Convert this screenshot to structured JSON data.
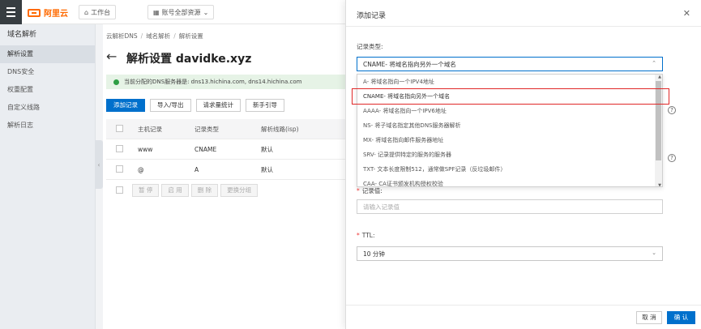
{
  "topbar": {
    "logo_text": "阿里云",
    "home_label": "工作台",
    "resource_label": "账号全部资源"
  },
  "sidebar": {
    "title": "域名解析",
    "items": [
      {
        "label": "解析设置",
        "active": true
      },
      {
        "label": "DNS安全"
      },
      {
        "label": "权重配置"
      },
      {
        "label": "自定义线路"
      },
      {
        "label": "解析日志"
      }
    ]
  },
  "main": {
    "breadcrumb": [
      "云解析DNS",
      "域名解析",
      "解析设置"
    ],
    "title": "解析设置 davidke.xyz",
    "notice": "当前分配的DNS服务器是: dns13.hichina.com, dns14.hichina.com",
    "buttons": [
      "添加记录",
      "导入/导出",
      "请求量统计",
      "新手引导"
    ],
    "columns": [
      "主机记录",
      "记录类型",
      "解析线路(isp)"
    ],
    "rows": [
      {
        "host": "www",
        "type": "CNAME",
        "line": "默认"
      },
      {
        "host": "@",
        "type": "A",
        "line": "默认"
      }
    ],
    "batch_buttons": [
      "暂 停",
      "启 用",
      "删 除",
      "更换分组"
    ]
  },
  "drawer": {
    "title": "添加记录",
    "record_type_label": "记录类型:",
    "record_type_value": "CNAME- 将域名指向另外一个域名",
    "options": [
      "A- 将域名指向一个IPV4地址",
      "CNAME- 将域名指向另外一个域名",
      "AAAA- 将域名指向一个IPV6地址",
      "NS- 将子域名指定其他DNS服务器解析",
      "MX- 将域名指向邮件服务器地址",
      "SRV- 记录提供特定的服务的服务器",
      "TXT- 文本长度限制512，通常做SPF记录（反垃圾邮件）",
      "CAA- CA证书颁发机构授权校验"
    ],
    "value_label": "记录值:",
    "value_placeholder": "请输入记录值",
    "ttl_label": "TTL:",
    "ttl_value": "10 分钟",
    "cancel_label": "取 消",
    "ok_label": "确 认"
  }
}
